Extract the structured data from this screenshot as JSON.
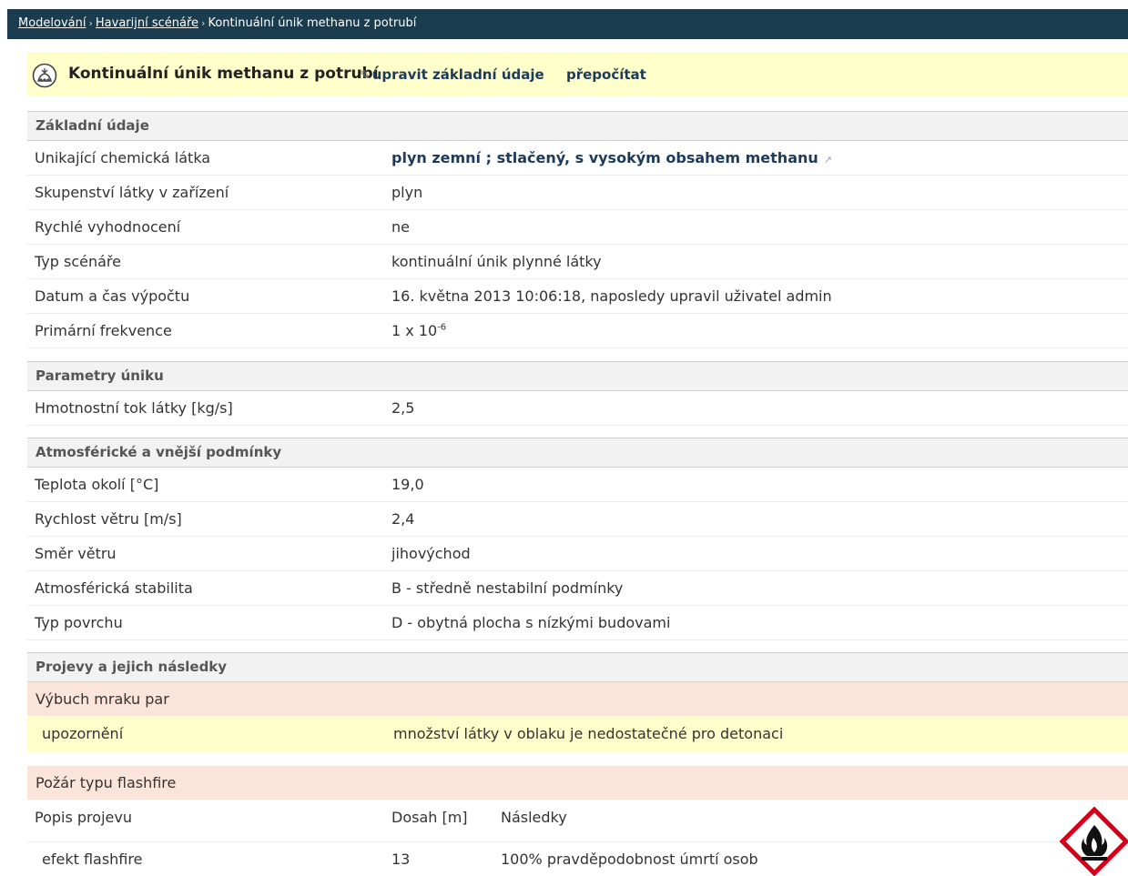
{
  "breadcrumb": {
    "item1": "Modelování",
    "item2": "Havarijní scénáře",
    "current": "Kontinuální únik methanu z potrubí",
    "separator": "›"
  },
  "header": {
    "title": "Kontinuální únik methanu z potrubí",
    "edit_label": "upravit základní údaje",
    "recalc_label": "přepočítat",
    "icon": "scenario-icon"
  },
  "sections": {
    "basic": "Základní údaje",
    "release": "Parametry úniku",
    "atmo": "Atmosférické a vnější podmínky",
    "effects": "Projevy a jejich následky"
  },
  "basic": {
    "substance_label": "Unikající chemická látka",
    "substance_value": "plyn zemní ; stlačený, s vysokým obsahem methanu",
    "state_label": "Skupenství látky v zařízení",
    "state_value": "plyn",
    "quick_label": "Rychlé vyhodnocení",
    "quick_value": "ne",
    "type_label": "Typ scénáře",
    "type_value": "kontinuální únik plynné látky",
    "date_label": "Datum a čas výpočtu",
    "date_value": "16. května 2013 10:06:18, naposledy upravil uživatel admin",
    "freq_label": "Primární frekvence",
    "freq_base": "1 x 10",
    "freq_exp": "-6"
  },
  "release": {
    "flow_label": "Hmotnostní tok látky [kg/s]",
    "flow_value": "2,5"
  },
  "atmo": {
    "temp_label": "Teplota okolí [°C]",
    "temp_value": "19,0",
    "wind_speed_label": "Rychlost větru [m/s]",
    "wind_speed_value": "2,4",
    "wind_dir_label": "Směr větru",
    "wind_dir_value": "jihovýchod",
    "stability_label": "Atmosférická stabilita",
    "stability_value": "B - středně nestabilní podmínky",
    "surface_label": "Typ povrchu",
    "surface_value": "D - obytná plocha s nízkými budovami"
  },
  "effects": {
    "vce_title": "Výbuch mraku par",
    "warn_label": "upozornění",
    "warn_value": "množství látky v oblaku je nedostatečné pro detonaci",
    "flash_title": "Požár typu flashfire",
    "col_desc": "Popis projevu",
    "col_range": "Dosah [m]",
    "col_conseq": "Následky",
    "row_desc": "efekt flashfire",
    "row_range": "13",
    "row_conseq": "100% pravděpodobnost úmrtí osob",
    "hazard_icon": "flammable-hazard-icon"
  },
  "colors": {
    "topbar": "#1b3c4f",
    "title_bg": "#ffffcc",
    "subhead_bg": "#fbe4d9",
    "link": "#1d3a5a",
    "hazard_red": "#d4001a"
  }
}
